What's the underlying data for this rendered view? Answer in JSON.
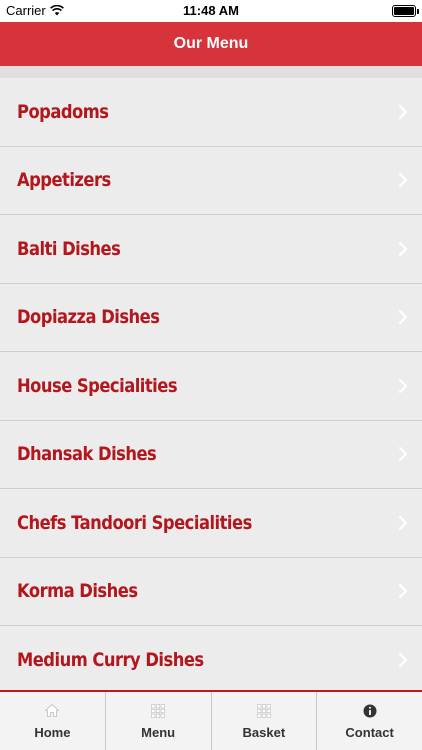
{
  "status_bar": {
    "carrier": "Carrier",
    "time": "11:48 AM"
  },
  "header": {
    "title": "Our Menu"
  },
  "menu": {
    "items": [
      {
        "label": "Popadoms"
      },
      {
        "label": "Appetizers"
      },
      {
        "label": "Balti Dishes"
      },
      {
        "label": "Dopiazza Dishes"
      },
      {
        "label": "House Specialities"
      },
      {
        "label": "Dhansak Dishes"
      },
      {
        "label": "Chefs Tandoori Specialities"
      },
      {
        "label": "Korma Dishes"
      },
      {
        "label": "Medium Curry Dishes"
      }
    ]
  },
  "tab_bar": {
    "tabs": [
      {
        "label": "Home",
        "icon": "home-icon"
      },
      {
        "label": "Menu",
        "icon": "grid-icon"
      },
      {
        "label": "Basket",
        "icon": "grid-icon"
      },
      {
        "label": "Contact",
        "icon": "info-icon"
      }
    ]
  },
  "colors": {
    "accent": "#d6343a",
    "menu_text": "#b3161c",
    "background": "#ececec"
  }
}
